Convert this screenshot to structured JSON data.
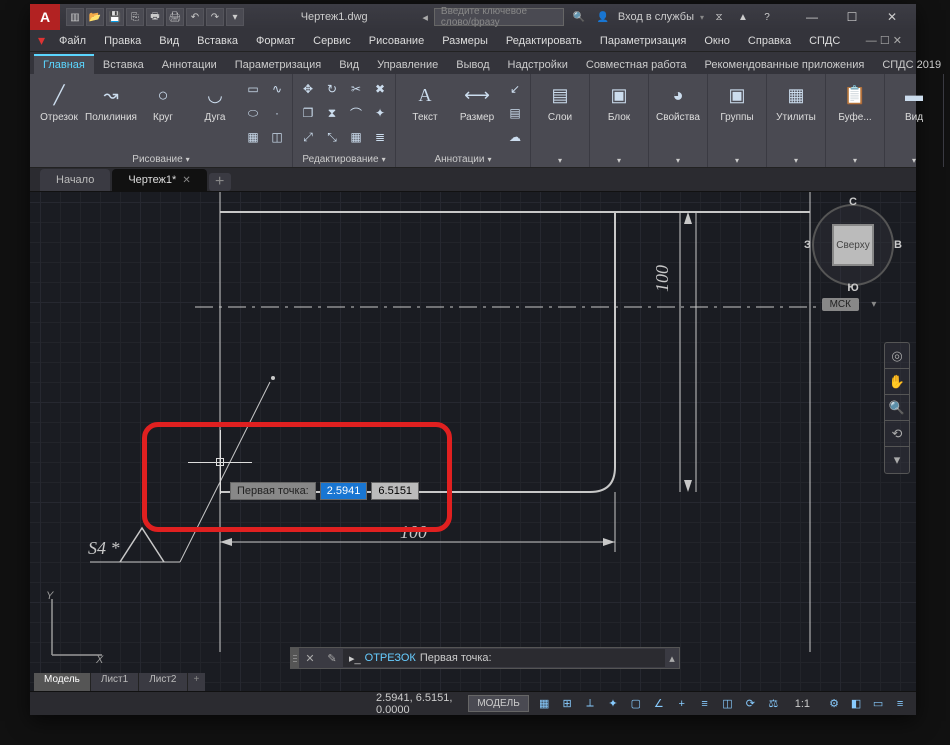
{
  "title": "Чертеж1.dwg",
  "search_placeholder": "Введите ключевое слово/фразу",
  "signin": "Вход в службы",
  "menubar": [
    "Файл",
    "Правка",
    "Вид",
    "Вставка",
    "Формат",
    "Сервис",
    "Рисование",
    "Размеры",
    "Редактировать",
    "Параметризация",
    "Окно",
    "Справка",
    "СПДС"
  ],
  "ribtabs": [
    "Главная",
    "Вставка",
    "Аннотации",
    "Параметризация",
    "Вид",
    "Управление",
    "Вывод",
    "Надстройки",
    "Совместная работа",
    "Рекомендованные приложения",
    "СПДС 2019"
  ],
  "ribbon": {
    "draw": {
      "title": "Рисование",
      "line": "Отрезок",
      "polyline": "Полилиния",
      "circle": "Круг",
      "arc": "Дуга"
    },
    "modify": {
      "title": "Редактирование"
    },
    "annot": {
      "title": "Аннотации",
      "text": "Текст",
      "dim": "Размер"
    },
    "layers": {
      "title": "Слои"
    },
    "block": {
      "title": "Блок"
    },
    "props": {
      "title": "Свойства"
    },
    "groups": {
      "title": "Группы"
    },
    "utils": {
      "title": "Утилиты"
    },
    "clip": {
      "title": "Буфе..."
    },
    "view": {
      "title": "Вид"
    }
  },
  "doctabs": {
    "start": "Начало",
    "active": "Чертеж1*"
  },
  "viewcube": {
    "face": "Сверху",
    "n": "С",
    "s": "Ю",
    "e": "В",
    "w": "З",
    "cs": "МСК"
  },
  "drawing": {
    "dim_h": "100",
    "dim_v": "100",
    "weld": "S4 *"
  },
  "dyninput": {
    "label": "Первая точка:",
    "x": "2.5941",
    "y": "6.5151"
  },
  "cmdline": {
    "keyword": "ОТРЕЗОК",
    "prompt": "Первая точка:"
  },
  "layouttabs": {
    "model": "Модель",
    "l1": "Лист1",
    "l2": "Лист2"
  },
  "statusbar": {
    "coords": "2.5941, 6.5151, 0.0000",
    "model": "МОДЕЛЬ",
    "scale": "1:1"
  }
}
